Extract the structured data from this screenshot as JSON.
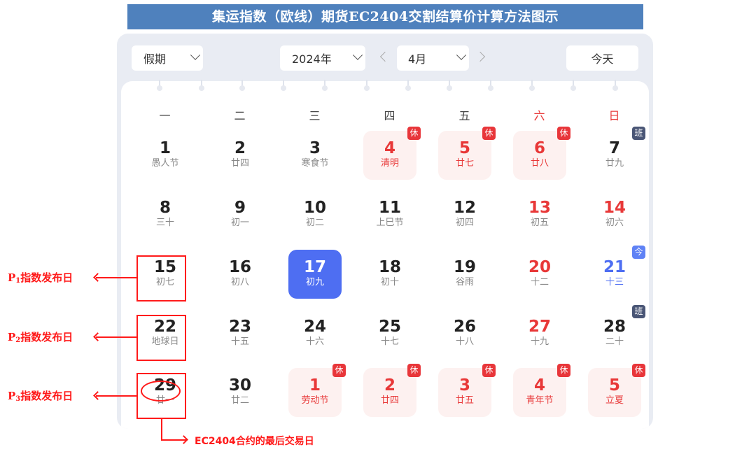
{
  "title": "集运指数（欧线）期货EC2404交割结算价计算方法图示",
  "toolbar": {
    "holiday_select": "假期",
    "year_select": "2024年",
    "month_select": "4月",
    "today_button": "今天"
  },
  "weekdays": [
    "一",
    "二",
    "三",
    "四",
    "五",
    "六",
    "日"
  ],
  "badges": {
    "rest": "休",
    "work": "班",
    "today": "今"
  },
  "weeks": [
    [
      {
        "day": "1",
        "sub": "愚人节"
      },
      {
        "day": "2",
        "sub": "廿四"
      },
      {
        "day": "3",
        "sub": "寒食节"
      },
      {
        "day": "4",
        "sub": "清明",
        "badge": "休"
      },
      {
        "day": "5",
        "sub": "廿七",
        "badge": "休"
      },
      {
        "day": "6",
        "sub": "廿八",
        "badge": "休"
      },
      {
        "day": "7",
        "sub": "廿九",
        "badge": "班"
      }
    ],
    [
      {
        "day": "8",
        "sub": "三十"
      },
      {
        "day": "9",
        "sub": "初一"
      },
      {
        "day": "10",
        "sub": "初二"
      },
      {
        "day": "11",
        "sub": "上巳节"
      },
      {
        "day": "12",
        "sub": "初四"
      },
      {
        "day": "13",
        "sub": "初五"
      },
      {
        "day": "14",
        "sub": "初六"
      }
    ],
    [
      {
        "day": "15",
        "sub": "初七"
      },
      {
        "day": "16",
        "sub": "初八"
      },
      {
        "day": "17",
        "sub": "初九",
        "selected": true
      },
      {
        "day": "18",
        "sub": "初十"
      },
      {
        "day": "19",
        "sub": "谷雨"
      },
      {
        "day": "20",
        "sub": "十二"
      },
      {
        "day": "21",
        "sub": "十三",
        "badge": "今"
      }
    ],
    [
      {
        "day": "22",
        "sub": "地球日"
      },
      {
        "day": "23",
        "sub": "十五"
      },
      {
        "day": "24",
        "sub": "十六"
      },
      {
        "day": "25",
        "sub": "十七"
      },
      {
        "day": "26",
        "sub": "十八"
      },
      {
        "day": "27",
        "sub": "十九"
      },
      {
        "day": "28",
        "sub": "二十",
        "badge": "班"
      }
    ],
    [
      {
        "day": "29",
        "sub": "廿一"
      },
      {
        "day": "30",
        "sub": "廿二"
      },
      {
        "day": "1",
        "sub": "劳动节",
        "badge": "休"
      },
      {
        "day": "2",
        "sub": "廿四",
        "badge": "休"
      },
      {
        "day": "3",
        "sub": "廿五",
        "badge": "休"
      },
      {
        "day": "4",
        "sub": "青年节",
        "badge": "休"
      },
      {
        "day": "5",
        "sub": "立夏",
        "badge": "休"
      }
    ]
  ],
  "annotations": {
    "p1": {
      "prefix": "P",
      "index": "1",
      "text": "指数发布日"
    },
    "p2": {
      "prefix": "P",
      "index": "2",
      "text": "指数发布日"
    },
    "p3": {
      "prefix": "P",
      "index": "3",
      "text": "指数发布日"
    },
    "last_trading_day": "EC2404合约的最后交易日"
  },
  "colors": {
    "title_bg": "#4f81bd",
    "rest_red": "#e83838",
    "today_blue": "#4e6ef2",
    "work_badge": "#4a5676",
    "annotation_red": "#ff1a1a"
  }
}
